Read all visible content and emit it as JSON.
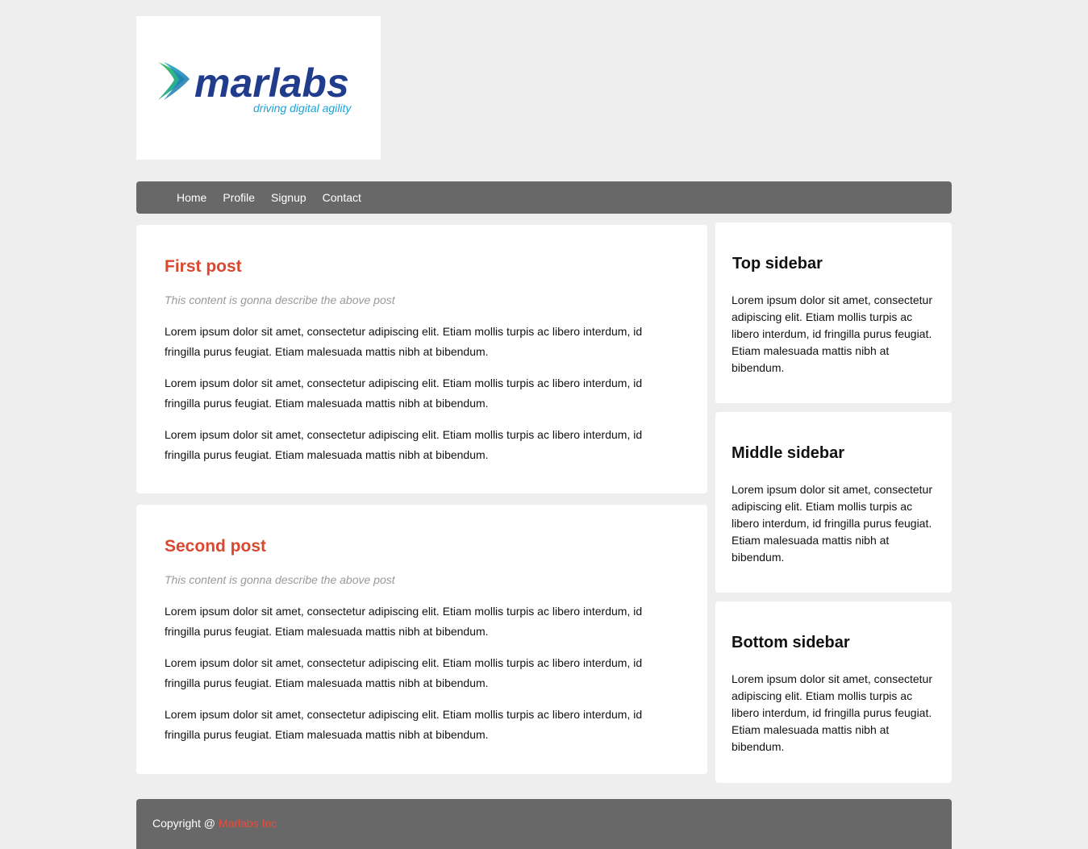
{
  "logo": {
    "brand": "marlabs",
    "tagline": "driving digital agility",
    "colors": {
      "brand_text": "#223c8c",
      "tagline_text": "#1aa3d9",
      "chevron_green": "#3bb54a",
      "chevron_teal": "#14a0b4",
      "chevron_blue": "#1f6fb4"
    }
  },
  "nav": {
    "items": [
      {
        "label": "Home"
      },
      {
        "label": "Profile"
      },
      {
        "label": "Signup"
      },
      {
        "label": "Contact"
      }
    ]
  },
  "posts": [
    {
      "title": "First post",
      "description": "This content is gonna describe the above post",
      "paragraphs": [
        "Lorem ipsum dolor sit amet, consectetur adipiscing elit. Etiam mollis turpis ac libero interdum, id fringilla purus feugiat. Etiam malesuada mattis nibh at bibendum.",
        "Lorem ipsum dolor sit amet, consectetur adipiscing elit. Etiam mollis turpis ac libero interdum, id fringilla purus feugiat. Etiam malesuada mattis nibh at bibendum.",
        "Lorem ipsum dolor sit amet, consectetur adipiscing elit. Etiam mollis turpis ac libero interdum, id fringilla purus feugiat. Etiam malesuada mattis nibh at bibendum."
      ]
    },
    {
      "title": "Second post",
      "description": "This content is gonna describe the above post",
      "paragraphs": [
        "Lorem ipsum dolor sit amet, consectetur adipiscing elit. Etiam mollis turpis ac libero interdum, id fringilla purus feugiat. Etiam malesuada mattis nibh at bibendum.",
        "Lorem ipsum dolor sit amet, consectetur adipiscing elit. Etiam mollis turpis ac libero interdum, id fringilla purus feugiat. Etiam malesuada mattis nibh at bibendum.",
        "Lorem ipsum dolor sit amet, consectetur adipiscing elit. Etiam mollis turpis ac libero interdum, id fringilla purus feugiat. Etiam malesuada mattis nibh at bibendum."
      ]
    }
  ],
  "sidebar": {
    "top": {
      "title": "Top sidebar",
      "text": "Lorem ipsum dolor sit amet, consectetur adipiscing elit. Etiam mollis turpis ac libero interdum, id fringilla purus feugiat. Etiam malesuada mattis nibh at bibendum."
    },
    "middle": {
      "title": "Middle sidebar",
      "text": "Lorem ipsum dolor sit amet, consectetur adipiscing elit. Etiam mollis turpis ac libero interdum, id fringilla purus feugiat. Etiam malesuada mattis nibh at bibendum."
    },
    "bottom": {
      "title": "Bottom sidebar",
      "text": "Lorem ipsum dolor sit amet, consectetur adipiscing elit. Etiam mollis turpis ac libero interdum, id fringilla purus feugiat. Etiam malesuada mattis nibh at bibendum."
    }
  },
  "footer": {
    "prefix": "Copyright @ ",
    "link_label": "Marlabs Inc"
  },
  "colors": {
    "page_background": "#eeeeee",
    "bar_background": "#686868",
    "post_title": "#d9482f",
    "footer_link": "#e84c3d",
    "description_text": "#999999"
  }
}
